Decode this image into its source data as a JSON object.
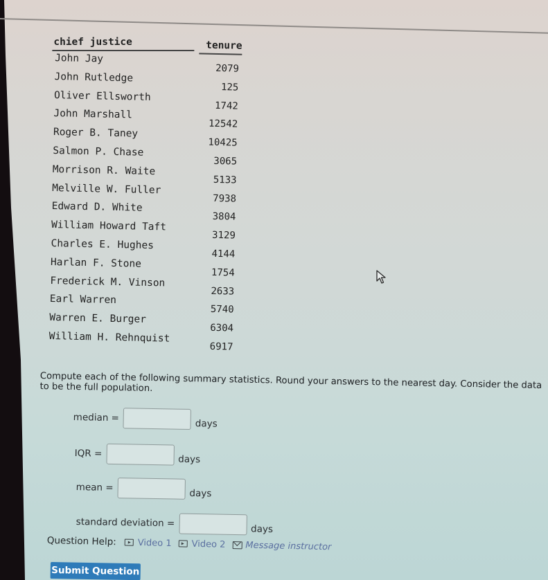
{
  "table": {
    "headers": {
      "name": "chief justice",
      "tenure": "tenure"
    },
    "rows": [
      {
        "name": "John Jay",
        "tenure": "2079"
      },
      {
        "name": "John Rutledge",
        "tenure": "125"
      },
      {
        "name": "Oliver Ellsworth",
        "tenure": "1742"
      },
      {
        "name": "John Marshall",
        "tenure": "12542"
      },
      {
        "name": "Roger B. Taney",
        "tenure": "10425"
      },
      {
        "name": "Salmon P. Chase",
        "tenure": "3065"
      },
      {
        "name": "Morrison R. Waite",
        "tenure": "5133"
      },
      {
        "name": "Melville W. Fuller",
        "tenure": "7938"
      },
      {
        "name": "Edward D. White",
        "tenure": "3804"
      },
      {
        "name": "William Howard Taft",
        "tenure": "3129"
      },
      {
        "name": "Charles E. Hughes",
        "tenure": "4144"
      },
      {
        "name": "Harlan F. Stone",
        "tenure": "1754"
      },
      {
        "name": "Frederick M. Vinson",
        "tenure": "2633"
      },
      {
        "name": "Earl Warren",
        "tenure": "5740"
      },
      {
        "name": "Warren E. Burger",
        "tenure": "6304"
      },
      {
        "name": "William H. Rehnquist",
        "tenure": "6917"
      }
    ]
  },
  "instructions": "Compute each of the following summary statistics. Round your answers to the nearest day. Consider the data to be the full population.",
  "questions": {
    "median": {
      "label": "median =",
      "value": "",
      "unit": "days"
    },
    "iqr": {
      "label": "IQR =",
      "value": "",
      "unit": "days"
    },
    "mean": {
      "label": "mean =",
      "value": "",
      "unit": "days"
    },
    "std_dev": {
      "label": "standard deviation =",
      "value": "",
      "unit": "days"
    }
  },
  "help": {
    "label": "Question Help:",
    "video1": "Video 1",
    "video2": "Video 2",
    "message": "Message instructor"
  },
  "submit_label": "Submit Question",
  "colors": {
    "submit_bg": "#2e7bb9",
    "link": "#5a6fa0"
  }
}
